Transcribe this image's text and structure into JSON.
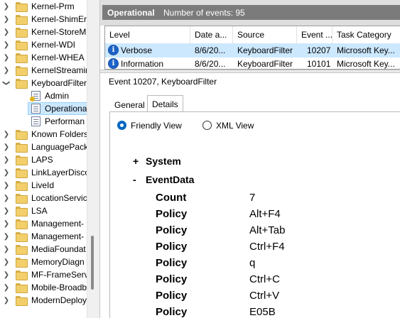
{
  "tree": {
    "items": [
      {
        "label": "Kernel-Prm",
        "icon": "folder-icon",
        "expanded": false
      },
      {
        "label": "Kernel-ShimEr",
        "icon": "folder-icon",
        "expanded": false
      },
      {
        "label": "Kernel-StoreM",
        "icon": "folder-icon",
        "expanded": false
      },
      {
        "label": "Kernel-WDI",
        "icon": "folder-icon",
        "expanded": false
      },
      {
        "label": "Kernel-WHEA",
        "icon": "folder-icon",
        "expanded": false
      },
      {
        "label": "KernelStreamin",
        "icon": "folder-icon",
        "expanded": false
      },
      {
        "label": "KeyboardFilter",
        "icon": "folder-icon",
        "expanded": true
      },
      {
        "label": "Admin",
        "icon": "admin-log-icon",
        "child": true
      },
      {
        "label": "Operational",
        "icon": "log-icon",
        "child": true,
        "selected": true
      },
      {
        "label": "Performan",
        "icon": "log-icon",
        "child": true
      },
      {
        "label": "Known Folders",
        "icon": "folder-icon",
        "expanded": false
      },
      {
        "label": "LanguagePack",
        "icon": "folder-icon",
        "expanded": false
      },
      {
        "label": "LAPS",
        "icon": "folder-icon",
        "expanded": false
      },
      {
        "label": "LinkLayerDisco",
        "icon": "folder-icon",
        "expanded": false
      },
      {
        "label": "LiveId",
        "icon": "folder-icon",
        "expanded": false
      },
      {
        "label": "LocationServic",
        "icon": "folder-icon",
        "expanded": false
      },
      {
        "label": "LSA",
        "icon": "folder-icon",
        "expanded": false
      },
      {
        "label": "Management-",
        "icon": "folder-icon",
        "expanded": false
      },
      {
        "label": "Management-",
        "icon": "folder-icon",
        "expanded": false
      },
      {
        "label": "MediaFoundat",
        "icon": "folder-icon",
        "expanded": false
      },
      {
        "label": "MemoryDiagn",
        "icon": "folder-icon",
        "expanded": false
      },
      {
        "label": "MF-FrameServ",
        "icon": "folder-icon",
        "expanded": false
      },
      {
        "label": "Mobile-Broadb",
        "icon": "folder-icon",
        "expanded": false
      },
      {
        "label": "ModernDeploy",
        "icon": "folder-icon",
        "expanded": false
      }
    ]
  },
  "log_header": {
    "title": "Operational",
    "count": "Number of events: 95"
  },
  "events": {
    "columns": [
      "Level",
      "Date a...",
      "Source",
      "Event ...",
      "Task Category"
    ],
    "rows": [
      {
        "level": "Verbose",
        "date": "8/6/20...",
        "source": "KeyboardFilter",
        "event_id": "10207",
        "task_category": "Microsoft Key...",
        "icon": "info-icon",
        "selected": true
      },
      {
        "level": "Information",
        "date": "8/6/20...",
        "source": "KeyboardFilter",
        "event_id": "10101",
        "task_category": "Microsoft Key...",
        "icon": "info-icon",
        "selected": false
      }
    ]
  },
  "details": {
    "title": "Event 10207, KeyboardFilter",
    "tabs": [
      "General",
      "Details"
    ],
    "active_tab": "Details",
    "view_options": [
      "Friendly View",
      "XML View"
    ],
    "selected_view": "Friendly View",
    "system": {
      "toggle": "+",
      "label": "System"
    },
    "event_data": {
      "toggle": "-",
      "label": "EventData",
      "fields": [
        {
          "name": "Count",
          "value": "7"
        },
        {
          "name": "Policy",
          "value": "Alt+F4"
        },
        {
          "name": "Policy",
          "value": "Alt+Tab"
        },
        {
          "name": "Policy",
          "value": "Ctrl+F4"
        },
        {
          "name": "Policy",
          "value": "q"
        },
        {
          "name": "Policy",
          "value": "Ctrl+C"
        },
        {
          "name": "Policy",
          "value": "Ctrl+V"
        },
        {
          "name": "Policy",
          "value": "E05B"
        }
      ]
    }
  },
  "colors": {
    "accent": "#0067c0",
    "selection": "#cce8ff",
    "header_bar": "#7b7b7b",
    "info_icon": "#1d63c8"
  }
}
